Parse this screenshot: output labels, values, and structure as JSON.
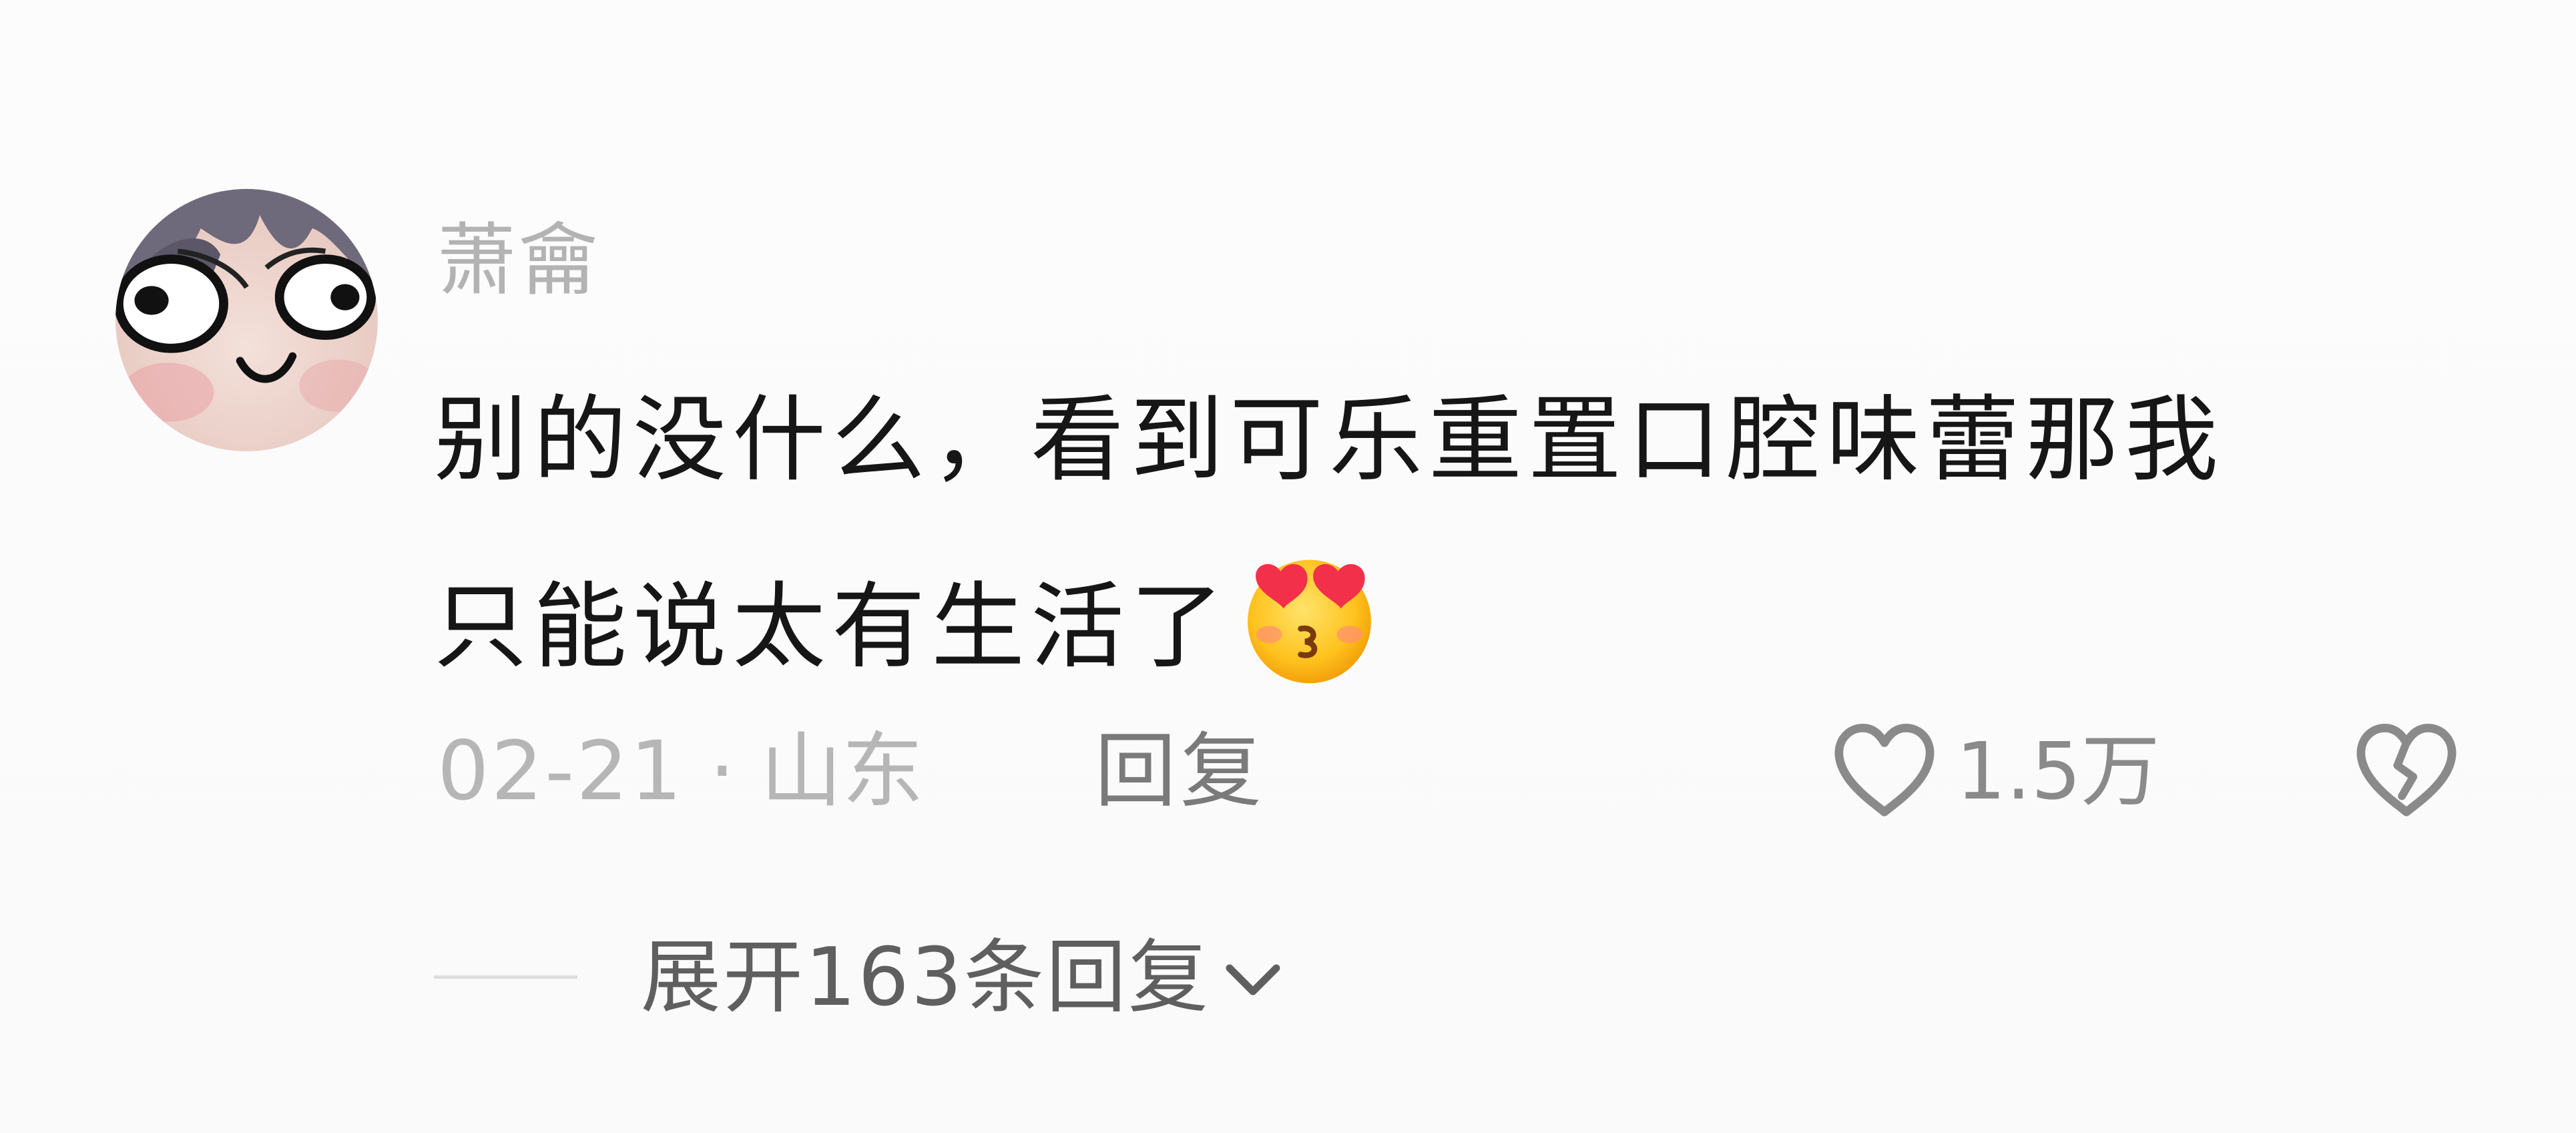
{
  "comment": {
    "username": "萧龠",
    "text_line_1": "别的没什么，看到可乐重置口腔味蕾那我",
    "text_line_2": "只能说太有生活了",
    "emoji": "heart-eyes-kiss-emoji",
    "date": "02-21",
    "separator": "·",
    "location": "山东",
    "reply_label": "回复",
    "like_count": "1.5万",
    "expand_label": "展开163条回复"
  },
  "colors": {
    "username": "#b3b3b3",
    "text": "#161616",
    "meta": "#b6b6b6",
    "reply": "#7a7a7a",
    "icon": "#8a8a8a"
  },
  "icons": {
    "like": "heart-outline-icon",
    "dislike": "broken-heart-icon",
    "expand": "chevron-down-icon"
  }
}
